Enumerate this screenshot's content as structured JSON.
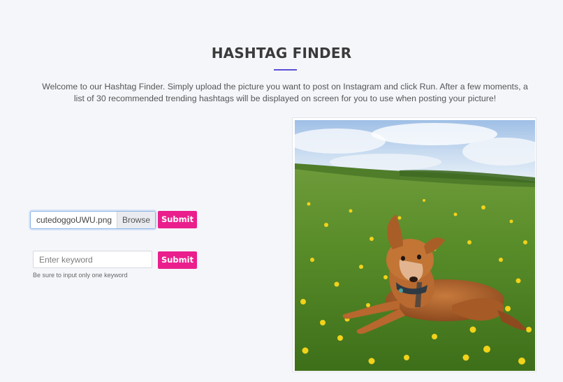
{
  "header": {
    "title": "HASHTAG FINDER",
    "intro": "Welcome to our Hashtag Finder. Simply upload the picture you want to post on Instagram and click Run. After a few moments, a list of 30 recommended trending hashtags will be displayed on screen for you to use when posting your picture!"
  },
  "upload": {
    "file_name": "cutedoggoUWU.png",
    "browse_label": "Browse",
    "submit_label": "Submit"
  },
  "keyword": {
    "placeholder": "Enter keyword",
    "value": "",
    "submit_label": "Submit",
    "help_text": "Be sure to input only one keyword"
  },
  "preview": {
    "image_icon": "dog-photo"
  },
  "colors": {
    "accent": "#5b4fd6",
    "button": "#ea1e8c",
    "background": "#f5f6fa"
  }
}
